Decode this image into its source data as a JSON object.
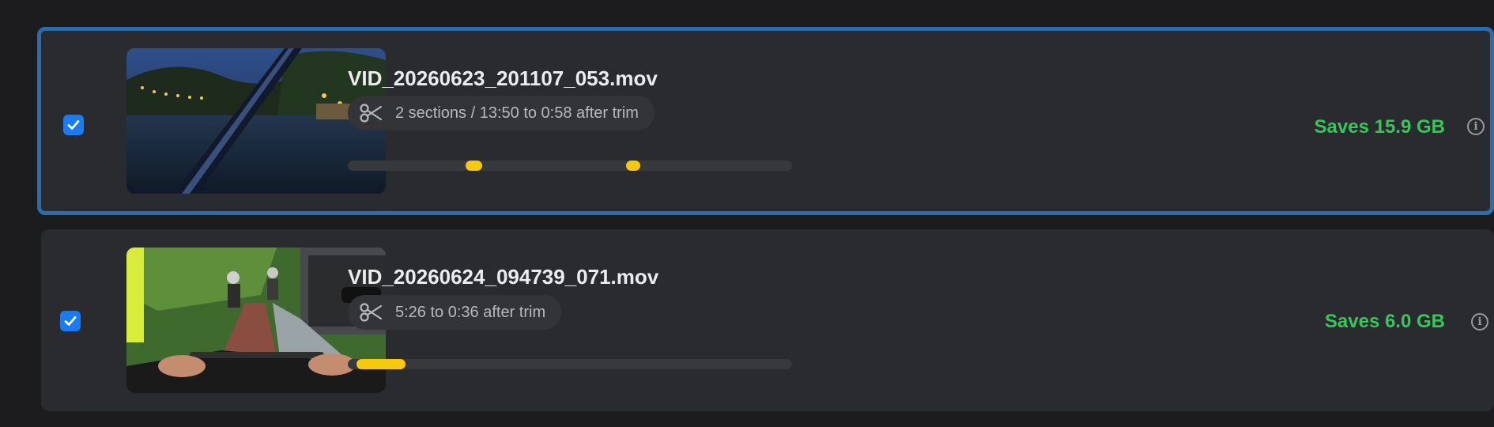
{
  "items": [
    {
      "filename": "VID_20260623_201107_053.mov",
      "trim_summary": "2 sections / 13:50 to 0:58 after trim",
      "savings": "Saves 15.9 GB",
      "checked": true,
      "selected": true,
      "segments": [
        {
          "start": 0.265,
          "end": 0.302
        },
        {
          "start": 0.627,
          "end": 0.659
        }
      ]
    },
    {
      "filename": "VID_20260624_094739_071.mov",
      "trim_summary": "5:26 to 0:36 after trim",
      "savings": "Saves 6.0 GB",
      "checked": true,
      "selected": false,
      "segments": [
        {
          "start": 0.02,
          "end": 0.13
        }
      ]
    }
  ],
  "icons": {
    "checkbox": "checkmark-icon",
    "trim": "scissors-icon",
    "info": "info-icon"
  },
  "colors": {
    "accent": "#1a7cf5",
    "selection_border": "#2b6cb0",
    "segment": "#f6c90a",
    "savings": "#34c759"
  }
}
